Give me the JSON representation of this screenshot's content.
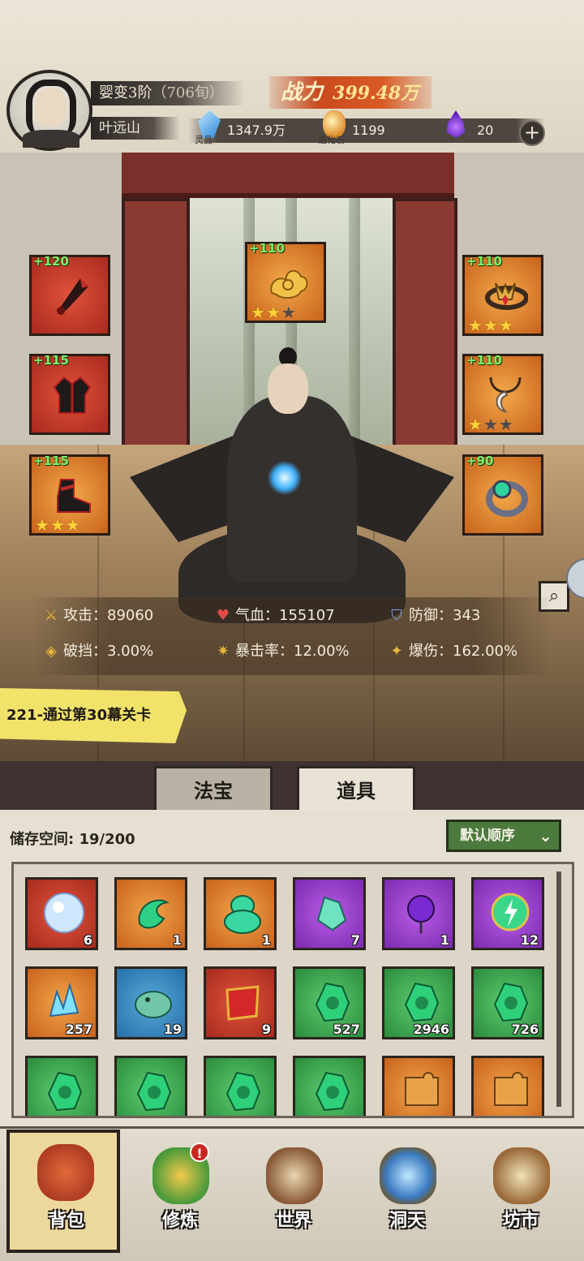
{
  "player": {
    "realm": "婴变3阶",
    "realm_age": "（706旬）",
    "name": "叶远山",
    "power_label": "战力",
    "power_value": "399.48万"
  },
  "currencies": [
    {
      "name": "灵晶",
      "value": "1347.9万",
      "icon": "blue-crystal-icon",
      "color": "#2f86d8"
    },
    {
      "name": "造化石",
      "value": "1199",
      "icon": "gold-stone-icon",
      "color": "#e08a2a"
    },
    {
      "name": "",
      "value": "20",
      "icon": "purple-flame-icon",
      "color": "#7a2ad0"
    }
  ],
  "add_button": "+",
  "equipment": [
    {
      "bonus": "+120",
      "icon": "dagger-icon",
      "color": "red",
      "stars": 0
    },
    {
      "bonus": "+110",
      "icon": "golden-cloud-icon",
      "color": "orange",
      "stars": 2
    },
    {
      "bonus": "+110",
      "icon": "crown-band-icon",
      "color": "orange",
      "stars": 3
    },
    {
      "bonus": "+115",
      "icon": "robe-armor-icon",
      "color": "red",
      "stars": 0
    },
    {
      "bonus": "+110",
      "icon": "pendant-necklace-icon",
      "color": "orange",
      "stars": 1
    },
    {
      "bonus": "+115",
      "icon": "boots-icon",
      "color": "orange",
      "stars": 3
    },
    {
      "bonus": "+90",
      "icon": "jade-ring-icon",
      "color": "orange",
      "stars": 0
    }
  ],
  "stats": [
    {
      "label": "攻击：",
      "value": "89060",
      "icon": "sword-icon"
    },
    {
      "label": "气血：",
      "value": "155107",
      "icon": "heart-icon"
    },
    {
      "label": "防御：",
      "value": "343",
      "icon": "shield-icon"
    },
    {
      "label": "破挡：",
      "value": "3.00%",
      "icon": "break-shield-icon"
    },
    {
      "label": "暴击率：",
      "value": "12.00%",
      "icon": "crit-rate-icon"
    },
    {
      "label": "爆伤：",
      "value": "162.00%",
      "icon": "crit-damage-icon"
    }
  ],
  "quest": {
    "text": "221-通过第30幕关卡"
  },
  "tabs": [
    {
      "label": "法宝",
      "active": false
    },
    {
      "label": "道具",
      "active": true
    }
  ],
  "inventory": {
    "storage_label": "储存空间:",
    "storage_value": "19/200",
    "sort_label": "默认顺序",
    "items": [
      {
        "count": "6",
        "color": "red",
        "icon": "spirit-orb-icon"
      },
      {
        "count": "1",
        "color": "orange",
        "icon": "jade-swirl-icon"
      },
      {
        "count": "1",
        "color": "orange",
        "icon": "jade-lotus-gourd-icon"
      },
      {
        "count": "7",
        "color": "purple",
        "icon": "green-crystal-shard-icon"
      },
      {
        "count": "1",
        "color": "purple",
        "icon": "purple-flower-icon"
      },
      {
        "count": "12",
        "color": "purple",
        "icon": "lightning-orb-icon"
      },
      {
        "count": "257",
        "color": "orange",
        "icon": "ice-crystal-icon"
      },
      {
        "count": "19",
        "color": "blue",
        "icon": "jade-beast-icon"
      },
      {
        "count": "9",
        "color": "red",
        "icon": "red-scroll-icon"
      },
      {
        "count": "527",
        "color": "green",
        "icon": "jade-slip-icon"
      },
      {
        "count": "2946",
        "color": "green",
        "icon": "jade-slip-icon"
      },
      {
        "count": "726",
        "color": "green",
        "icon": "jade-slip-icon"
      },
      {
        "count": "",
        "color": "green",
        "icon": "jade-slip-icon"
      },
      {
        "count": "",
        "color": "green",
        "icon": "jade-slip-icon"
      },
      {
        "count": "",
        "color": "green",
        "icon": "jade-slip-icon"
      },
      {
        "count": "",
        "color": "green",
        "icon": "jade-slip-icon"
      },
      {
        "count": "",
        "color": "orange",
        "icon": "puzzle-piece-icon"
      },
      {
        "count": "",
        "color": "orange",
        "icon": "puzzle-piece-icon"
      }
    ]
  },
  "nav": [
    {
      "label": "背包",
      "icon": "bag-icon",
      "active": true,
      "badge": ""
    },
    {
      "label": "修炼",
      "icon": "lotus-plant-icon",
      "active": false,
      "badge": "!"
    },
    {
      "label": "世界",
      "icon": "scroll-map-icon",
      "active": false,
      "badge": ""
    },
    {
      "label": "洞天",
      "icon": "portal-icon",
      "active": false,
      "badge": ""
    },
    {
      "label": "坊市",
      "icon": "market-stall-icon",
      "active": false,
      "badge": ""
    }
  ]
}
